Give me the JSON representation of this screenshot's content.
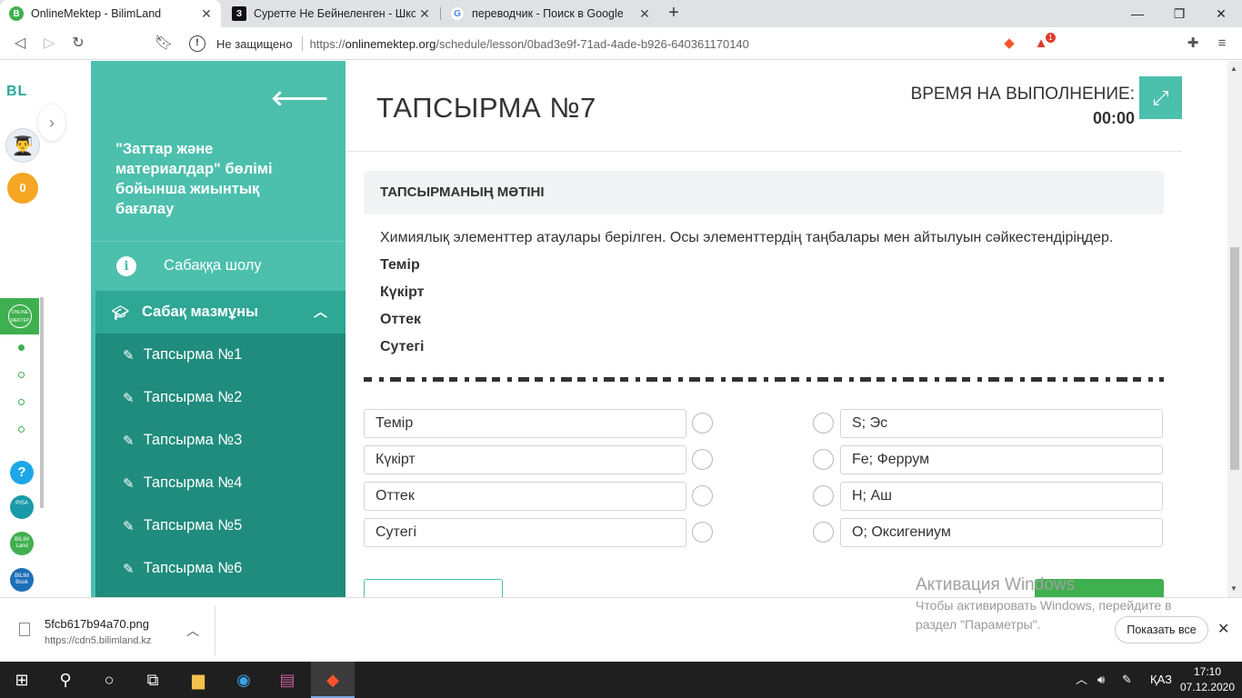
{
  "browser": {
    "tabs": [
      {
        "title": "OnlineMektep - BilimLand",
        "active": true
      },
      {
        "title": "Суретте Не Бейнеленген - Школь",
        "active": false
      },
      {
        "title": "переводчик - Поиск в Google",
        "active": false
      }
    ],
    "security_label": "Не защищено",
    "url_prefix": "https://",
    "url_host": "onlinemektep.org",
    "url_path": "/schedule/lesson/0bad3e9f-71ad-4ade-b926-640361170140",
    "ext_badge": "1"
  },
  "rail": {
    "logo": "BL",
    "coins": "0",
    "online_label": "ONLINE MEKTEP",
    "help": "?",
    "apps": [
      "PISA",
      "BILIM Land",
      "BILIM Book"
    ]
  },
  "sidebar": {
    "title": "\"Заттар және материалдар\" бөлімі бойынша жиынтық бағалау",
    "overview": "Сабаққа шолу",
    "content": "Сабақ мазмұны",
    "items": [
      "Тапсырма №1",
      "Тапсырма №2",
      "Тапсырма №3",
      "Тапсырма №4",
      "Тапсырма №5",
      "Тапсырма №6"
    ]
  },
  "main": {
    "task_title": "ТАПСЫРМА №7",
    "timer_label": "ВРЕМЯ НА ВЫПОЛНЕНИЕ:",
    "timer_value": "00:00",
    "text_heading": "ТАПСЫРМАНЫҢ МӘТІНІ",
    "task_text": "Химиялық элементтер атаулары берілген. Осы элементтердің таңбалары мен айтылуын сәйкестендіріңдер.",
    "elements": [
      "Темір",
      "Күкірт",
      "Оттек",
      "Сутегі"
    ],
    "left_options": [
      "Темір",
      "Күкірт",
      "Оттек",
      "Сутегі"
    ],
    "right_options": [
      "S; Эс",
      "Fe; Феррум",
      "H; Аш",
      "O; Оксигениум"
    ]
  },
  "watermark": {
    "title": "Активация Windows",
    "subtitle": "Чтобы активировать Windows, перейдите в раздел \"Параметры\"."
  },
  "download": {
    "filename": "5fcb617b94a70.png",
    "source": "https://cdn5.bilimland.kz",
    "show_all": "Показать все"
  },
  "taskbar": {
    "lang": "ҚАЗ",
    "time": "17:10",
    "date": "07.12.2020"
  }
}
